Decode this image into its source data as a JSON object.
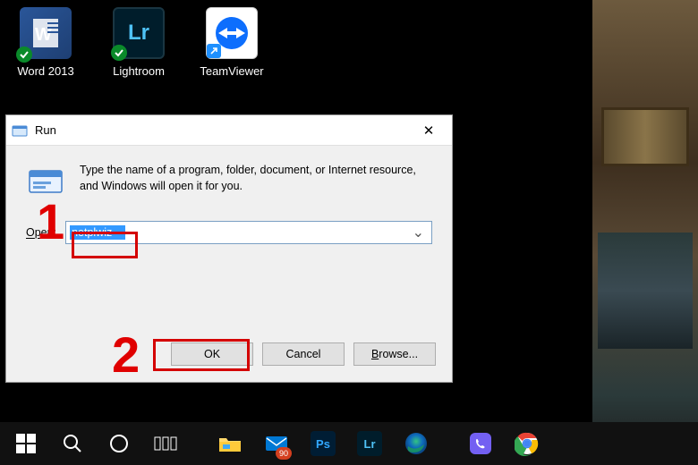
{
  "desktop_icons": [
    {
      "id": "word",
      "label": "Word 2013"
    },
    {
      "id": "lightroom",
      "label": "Lightroom"
    },
    {
      "id": "teamviewer",
      "label": "TeamViewer"
    }
  ],
  "run_dialog": {
    "title": "Run",
    "description": "Type the name of a program, folder, document, or Internet resource, and Windows will open it for you.",
    "open_label": "Open:",
    "open_value": "netplwiz",
    "buttons": {
      "ok": "OK",
      "cancel": "Cancel",
      "browse": "Browse..."
    },
    "close_glyph": "✕"
  },
  "annotations": {
    "step1": "1",
    "step2": "2"
  },
  "taskbar": {
    "mail_badge": "90"
  },
  "icons": {
    "lr_text": "Lr",
    "ps_text": "Ps"
  }
}
